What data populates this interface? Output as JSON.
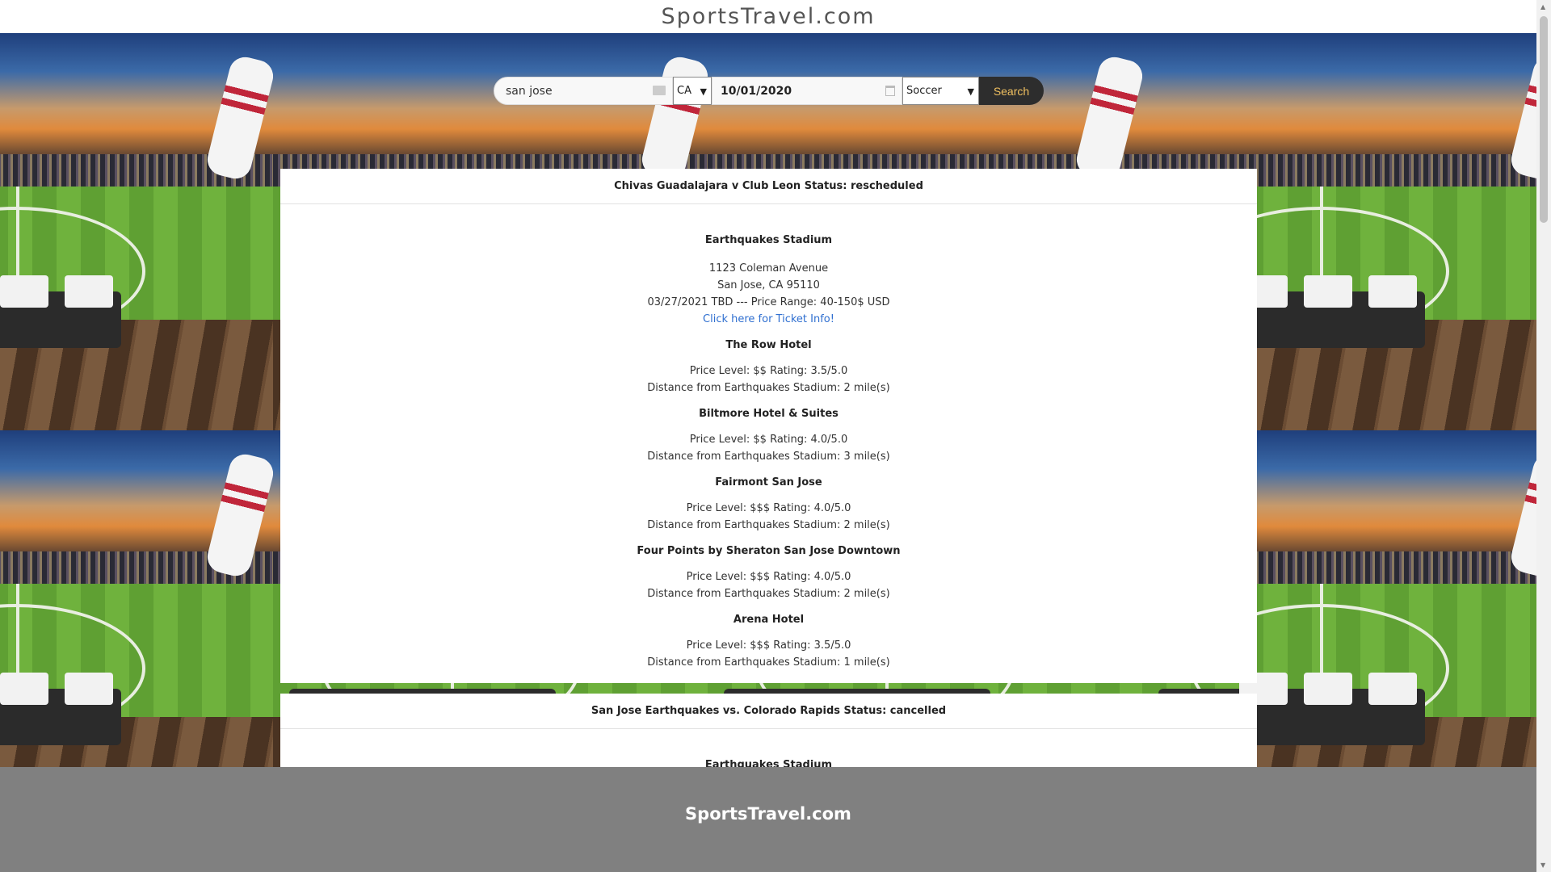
{
  "header": {
    "logo": "SportsTravel.com"
  },
  "search": {
    "city_value": "san jose",
    "state_value": "CA",
    "date_value": "10/01/2020",
    "sport_value": "Soccer",
    "button_label": "Search"
  },
  "events": [
    {
      "title": "Chivas Guadalajara v Club Leon Status: rescheduled",
      "venue": "Earthquakes Stadium",
      "address_line1": "1123 Coleman Avenue",
      "address_line2": "San Jose, CA 95110",
      "date_price": "03/27/2021 TBD --- Price Range: 40-150$ USD",
      "ticket_link": "Click here for Ticket Info!",
      "hotels": [
        {
          "name": "The Row Hotel",
          "price_rating": "Price Level: $$ Rating: 3.5/5.0",
          "distance": "Distance from Earthquakes Stadium: 2 mile(s)"
        },
        {
          "name": "Biltmore Hotel & Suites",
          "price_rating": "Price Level: $$ Rating: 4.0/5.0",
          "distance": "Distance from Earthquakes Stadium: 3 mile(s)"
        },
        {
          "name": "Fairmont San Jose",
          "price_rating": "Price Level: $$$ Rating: 4.0/5.0",
          "distance": "Distance from Earthquakes Stadium: 2 mile(s)"
        },
        {
          "name": "Four Points by Sheraton San Jose Downtown",
          "price_rating": "Price Level: $$$ Rating: 4.0/5.0",
          "distance": "Distance from Earthquakes Stadium: 2 mile(s)"
        },
        {
          "name": "Arena Hotel",
          "price_rating": "Price Level: $$$ Rating: 3.5/5.0",
          "distance": "Distance from Earthquakes Stadium: 1 mile(s)"
        }
      ]
    },
    {
      "title": "San Jose Earthquakes vs. Colorado Rapids Status: cancelled",
      "venue": "Earthquakes Stadium"
    }
  ],
  "footer": {
    "title": "SportsTravel.com"
  }
}
